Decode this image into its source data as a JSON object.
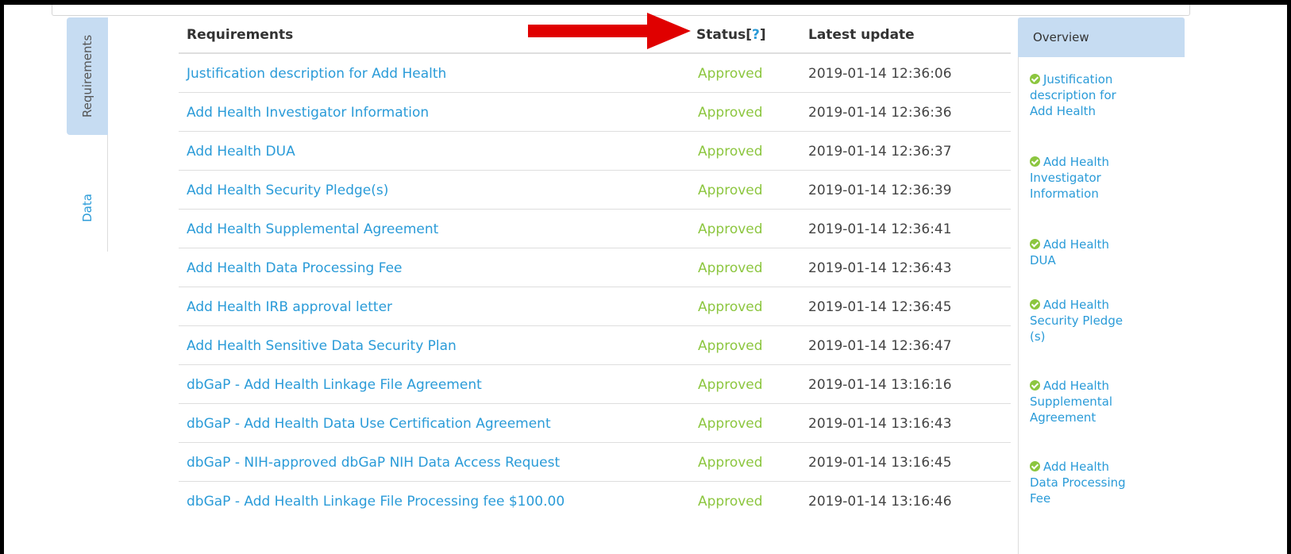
{
  "tabs": {
    "requirements_label": "Requirements",
    "data_label": "Data"
  },
  "table": {
    "headers": {
      "requirements": "Requirements",
      "status": "Status",
      "help_open": "[",
      "help_mark": "?",
      "help_close": "]",
      "latest_update": "Latest update"
    },
    "rows": [
      {
        "name": "Justification description for Add Health",
        "status": "Approved",
        "date": "2019-01-14 12:36:06"
      },
      {
        "name": "Add Health Investigator Information",
        "status": "Approved",
        "date": "2019-01-14 12:36:36"
      },
      {
        "name": "Add Health DUA",
        "status": "Approved",
        "date": "2019-01-14 12:36:37"
      },
      {
        "name": "Add Health Security Pledge(s)",
        "status": "Approved",
        "date": "2019-01-14 12:36:39"
      },
      {
        "name": "Add Health Supplemental Agreement",
        "status": "Approved",
        "date": "2019-01-14 12:36:41"
      },
      {
        "name": "Add Health Data Processing Fee",
        "status": "Approved",
        "date": "2019-01-14 12:36:43"
      },
      {
        "name": "Add Health IRB approval letter",
        "status": "Approved",
        "date": "2019-01-14 12:36:45"
      },
      {
        "name": "Add Health Sensitive Data Security Plan",
        "status": "Approved",
        "date": "2019-01-14 12:36:47"
      },
      {
        "name": "dbGaP - Add Health Linkage File Agreement",
        "status": "Approved",
        "date": "2019-01-14 13:16:16"
      },
      {
        "name": "dbGaP - Add Health Data Use Certification Agreement",
        "status": "Approved",
        "date": "2019-01-14 13:16:43"
      },
      {
        "name": "dbGaP - NIH-approved dbGaP NIH Data Access Request",
        "status": "Approved",
        "date": "2019-01-14 13:16:45"
      },
      {
        "name": "dbGaP - Add Health Linkage File Processing fee $100.00",
        "status": "Approved",
        "date": "2019-01-14 13:16:46"
      }
    ]
  },
  "overview": {
    "title": "Overview",
    "items": [
      {
        "icon": "check-circle-icon",
        "lines": [
          "Justification",
          "description for",
          "Add Health"
        ]
      },
      {
        "icon": "check-circle-icon",
        "lines": [
          "Add Health",
          "Investigator",
          "Information"
        ]
      },
      {
        "icon": "check-circle-icon",
        "lines": [
          "Add Health",
          "DUA"
        ]
      },
      {
        "icon": "check-circle-icon",
        "lines": [
          "Add Health",
          "Security Pledge",
          "(s)"
        ]
      },
      {
        "icon": "check-circle-icon",
        "lines": [
          "Add Health",
          "Supplemental",
          "Agreement"
        ]
      },
      {
        "icon": "check-circle-icon",
        "lines": [
          "Add Health",
          "Data Processing",
          "Fee"
        ]
      }
    ]
  },
  "colors": {
    "link": "#2a9bd8",
    "approved": "#8cc63f",
    "tab_active": "#c6dcf2",
    "arrow": "#e00000"
  }
}
